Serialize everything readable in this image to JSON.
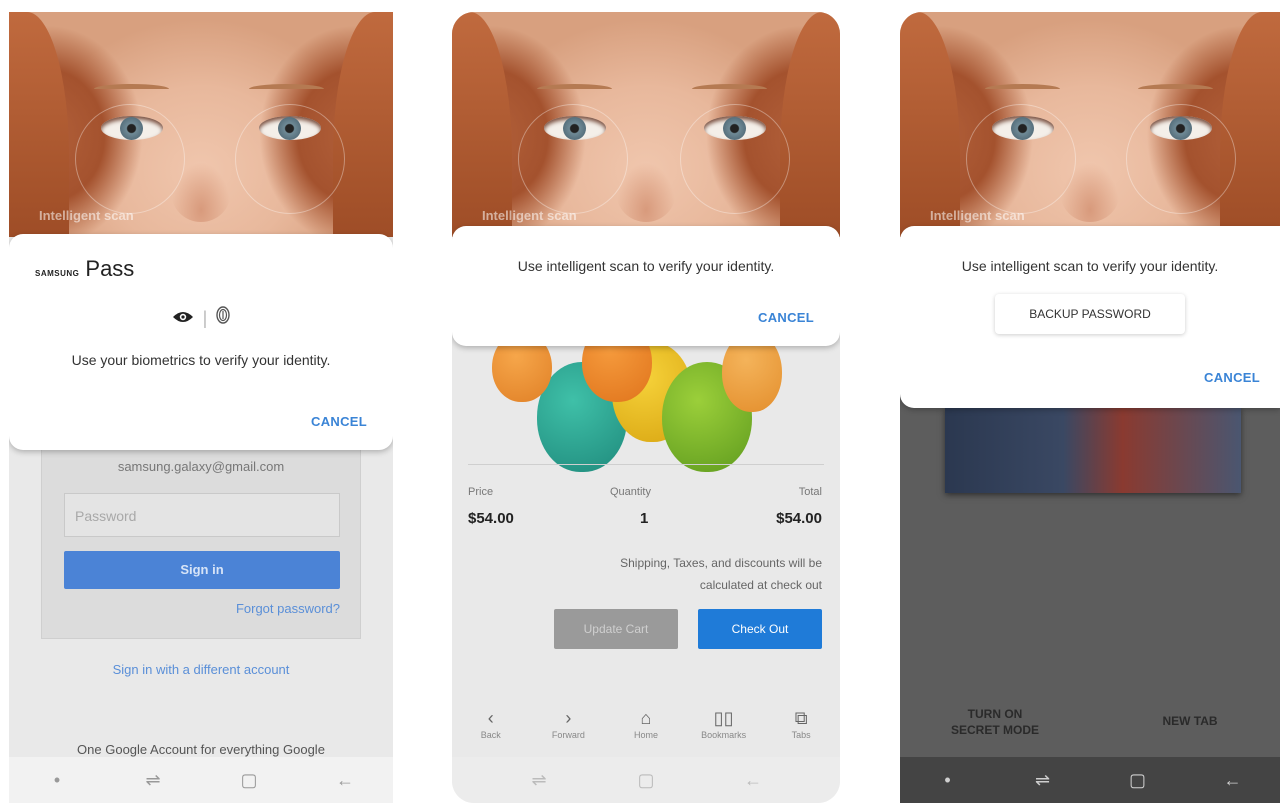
{
  "phone1": {
    "watermark": "Intelligent scan",
    "brand_small": "SAMSUNG",
    "brand_large": "Pass",
    "icons": [
      "eye-icon",
      "fingerprint-icon"
    ],
    "message": "Use your biometrics to verify your identity.",
    "cancel": "CANCEL",
    "email": "samsung.galaxy@gmail.com",
    "password_placeholder": "Password",
    "sign_in": "Sign in",
    "forgot": "Forgot password?",
    "different_account": "Sign in with a different account",
    "footer": "One Google Account for everything Google"
  },
  "phone2": {
    "watermark": "Intelligent scan",
    "message": "Use intelligent scan to verify your identity.",
    "cancel": "CANCEL",
    "headers": {
      "price": "Price",
      "quantity": "Quantity",
      "total": "Total"
    },
    "values": {
      "price": "$54.00",
      "quantity": "1",
      "total": "$54.00"
    },
    "shipping_line1": "Shipping, Taxes, and discounts will be",
    "shipping_line2": "calculated at check out",
    "update_cart": "Update Cart",
    "check_out": "Check Out",
    "toolbar": [
      {
        "icon": "back-icon",
        "label": "Back"
      },
      {
        "icon": "forward-icon",
        "label": "Forward"
      },
      {
        "icon": "home-icon",
        "label": "Home"
      },
      {
        "icon": "bookmarks-icon",
        "label": "Bookmarks"
      },
      {
        "icon": "tabs-icon",
        "label": "Tabs"
      }
    ],
    "colors": {
      "check_out": "#1f7bd8",
      "update_cart": "#9a9a9a",
      "cancel": "#3a84d6"
    }
  },
  "phone3": {
    "watermark": "Intelligent scan",
    "message": "Use intelligent scan to verify your identity.",
    "backup_password": "BACKUP PASSWORD",
    "cancel": "CANCEL",
    "secret_mode_line1": "TURN ON",
    "secret_mode_line2": "SECRET MODE",
    "new_tab": "NEW TAB"
  },
  "navbar": {
    "icons": [
      "dot-icon",
      "recents-icon",
      "home-square-icon",
      "back-arrow-icon"
    ]
  }
}
